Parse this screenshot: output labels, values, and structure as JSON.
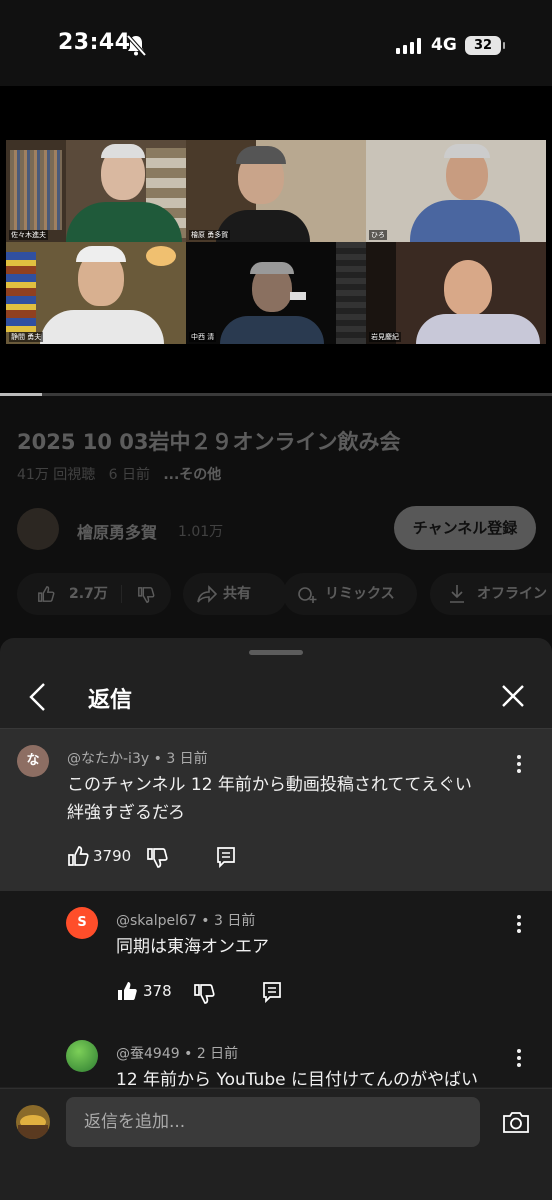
{
  "status_bar": {
    "time": "23:44",
    "network": "4G",
    "battery": "32"
  },
  "video": {
    "participants": [
      "佐々木進夫",
      "檜原 勇多賀",
      "ひろ",
      "静間 勇夫",
      "中西 清",
      "岩見慶紀"
    ],
    "progress": 0.076
  },
  "video_info": {
    "title": "2025 10 03岩中２９オンライン飲み会",
    "views": "41万 回視聴",
    "age": "6 日前",
    "more": "...その他",
    "channel_name": "檜原勇多賀",
    "subscribers": "1.01万",
    "subscribe_label": "チャンネル登録",
    "like_count": "2.7万",
    "share_label": "共有",
    "remix_label": "リミックス",
    "offline_label": "オフライン"
  },
  "sheet": {
    "title": "返信",
    "parent_comment": {
      "avatar_letter": "な",
      "author": "@なたか-i3y",
      "age": "3 日前",
      "text_line1": "このチャンネル 12 年前から動画投稿されててえぐい",
      "text_line2": "絆強すぎるだろ",
      "likes": "3790"
    },
    "replies": [
      {
        "avatar_letter": "S",
        "author": "@skalpel67",
        "age": "3 日前",
        "text": "同期は東海オンエア",
        "likes": "378"
      },
      {
        "avatar_letter": "",
        "author": "@蚕4949",
        "age": "2 日前",
        "text": "12 年前から YouTube に目付けてんのがやばい",
        "likes": ""
      }
    ],
    "reply_placeholder": "返信を追加..."
  },
  "colors": {
    "accent_red": "#ff4e2a",
    "avatar_na": "#8d6e63",
    "avatar_green": "#4caf50"
  }
}
